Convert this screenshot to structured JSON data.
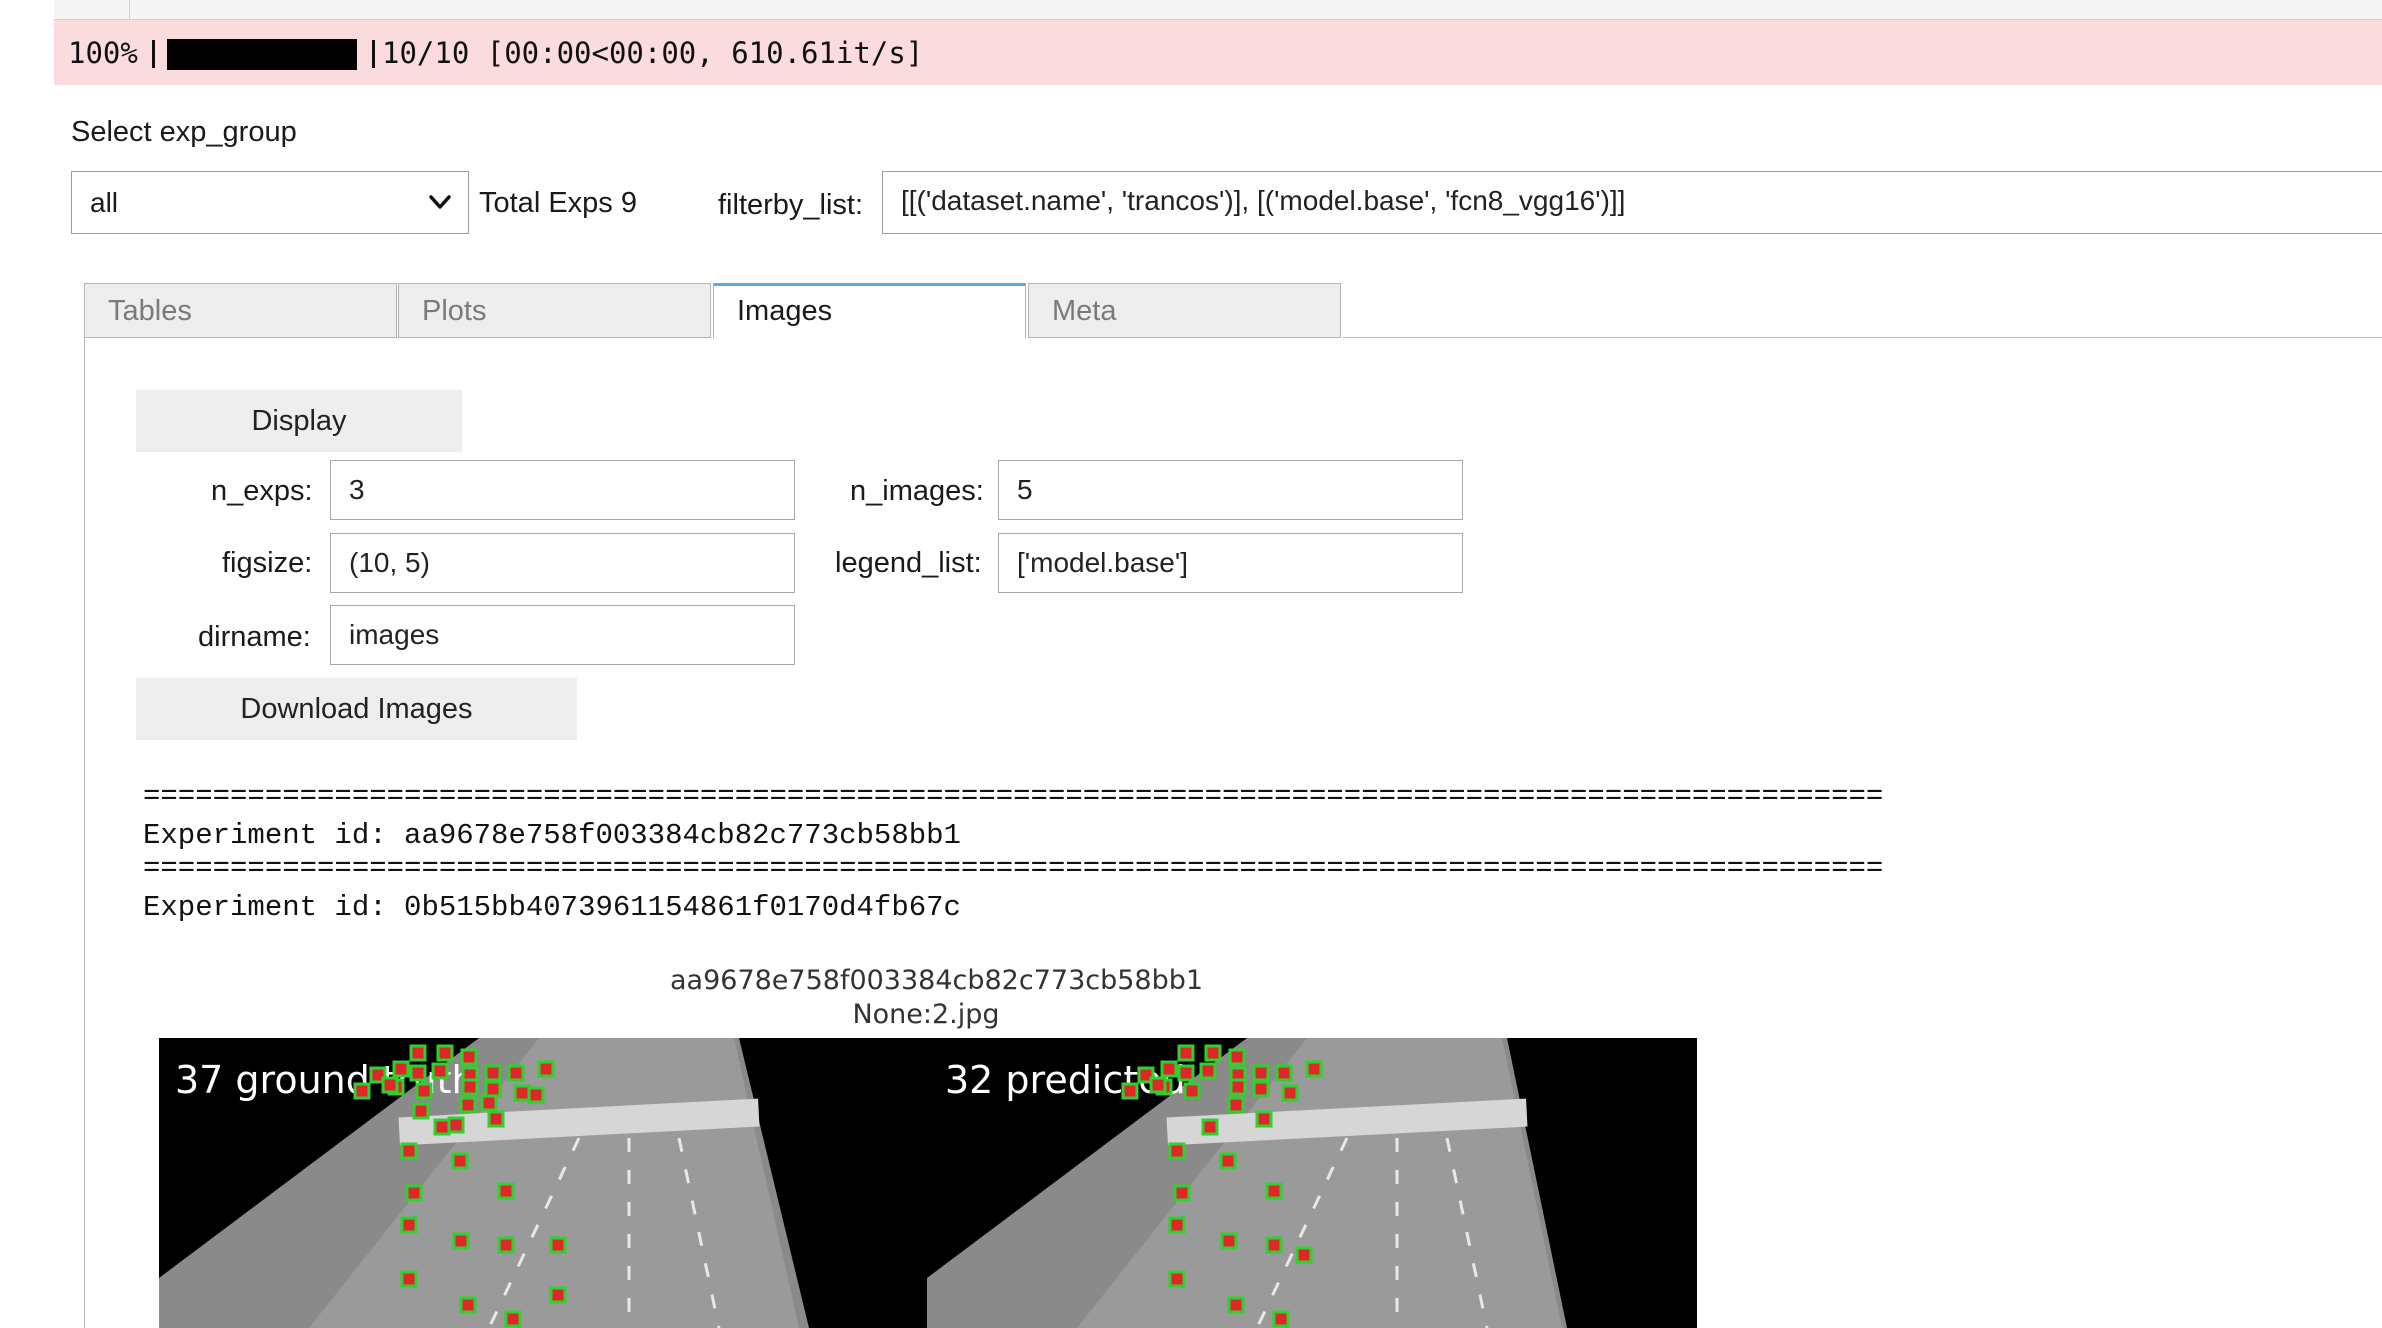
{
  "progress": {
    "percent_label": "100%",
    "fraction": 1.0,
    "stats": "10/10 [00:00<00:00, 610.61it/s]"
  },
  "exp_group": {
    "label": "Select exp_group",
    "selected": "all",
    "total_label": "Total Exps 9"
  },
  "filter": {
    "label": "filterby_list:",
    "value": "[[('dataset.name', 'trancos')], [('model.base', 'fcn8_vgg16')]]"
  },
  "tabs": [
    {
      "label": "Tables",
      "active": false
    },
    {
      "label": "Plots",
      "active": false
    },
    {
      "label": "Images",
      "active": true
    },
    {
      "label": "Meta",
      "active": false
    }
  ],
  "images_panel": {
    "display_button": "Display",
    "download_button": "Download Images",
    "fields": {
      "n_exps": {
        "label": "n_exps:",
        "value": "3"
      },
      "n_images": {
        "label": "n_images:",
        "value": "5"
      },
      "figsize": {
        "label": "figsize:",
        "value": "(10, 5)"
      },
      "legend_list": {
        "label": "legend_list:",
        "value": "['model.base']"
      },
      "dirname": {
        "label": "dirname:",
        "value": "images"
      }
    }
  },
  "output": {
    "separator": "====================================================================================================",
    "lines": [
      "Experiment id: aa9678e758f003384cb82c773cb58bb1",
      "Experiment id: 0b515bb4073961154861f0170d4fb67c"
    ]
  },
  "figure": {
    "title": "aa9678e758f003384cb82c773cb58bb1",
    "subtitle": "None:2.jpg",
    "left_caption": "37 ground truth",
    "right_caption": "32 predicted",
    "colors": {
      "marker_fill": "#e0262b",
      "marker_border": "#2fd12f",
      "road": "#8c8c8c",
      "background": "#000000"
    }
  }
}
